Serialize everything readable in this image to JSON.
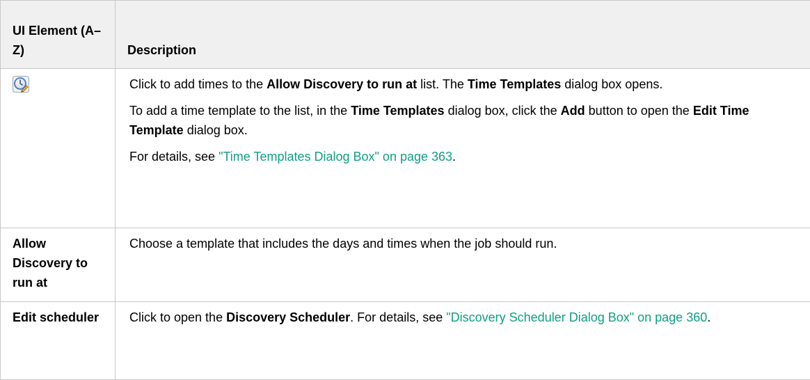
{
  "table": {
    "headers": {
      "element": "UI Element (A–Z)",
      "description": "Description"
    },
    "rows": [
      {
        "icon": "clock-pencil-icon",
        "p1": {
          "a": "Click to add times to the ",
          "b": "Allow Discovery to run at",
          "c": " list. The ",
          "d": "Time Templates",
          "e": " dialog box opens."
        },
        "p2": {
          "a": "To add a time template to the list, in the ",
          "b": "Time Templates",
          "c": " dialog box, click the ",
          "d": "Add",
          "e": " button to open the ",
          "f": "Edit Time Template",
          "g": " dialog box."
        },
        "p3": {
          "a": "For details, see ",
          "link": "\"Time Templates Dialog Box\" on page 363",
          "b": "."
        }
      },
      {
        "element": "Allow Discovery to run at",
        "description": "Choose a template that includes the days and times when the job should run."
      },
      {
        "element": "Edit scheduler",
        "p1": {
          "a": "Click to open the ",
          "b": "Discovery Scheduler",
          "c": ". For details, see ",
          "link": "\"Discovery Scheduler Dialog Box\" on page 360",
          "d": "."
        }
      }
    ]
  },
  "colors": {
    "link": "#0f9e86",
    "header_bg": "#f0f0f0",
    "border": "#c8c8c8"
  }
}
